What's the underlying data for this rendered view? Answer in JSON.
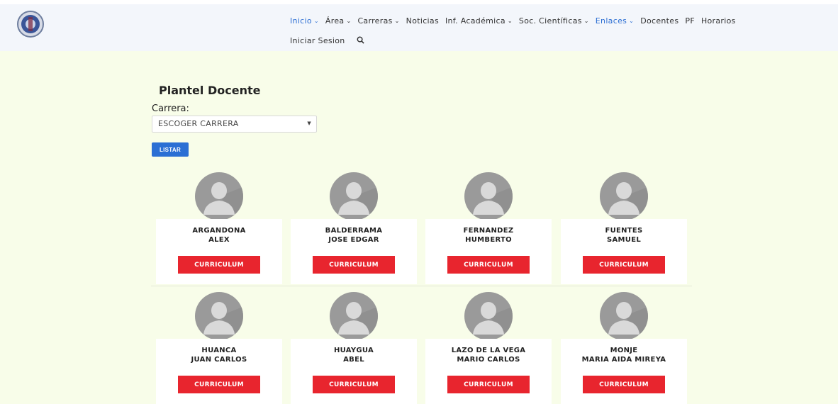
{
  "nav": {
    "row1": [
      {
        "label": "Inicio",
        "dropdown": true,
        "active": true
      },
      {
        "label": "Área",
        "dropdown": true,
        "active": false
      },
      {
        "label": "Carreras",
        "dropdown": true,
        "active": false
      },
      {
        "label": "Noticias",
        "dropdown": false,
        "active": false
      },
      {
        "label": "Inf. Académica",
        "dropdown": true,
        "active": false
      },
      {
        "label": "Soc. Científicas",
        "dropdown": true,
        "active": false
      },
      {
        "label": "Enlaces",
        "dropdown": true,
        "active": true
      },
      {
        "label": "Docentes",
        "dropdown": false,
        "active": false
      },
      {
        "label": "PF",
        "dropdown": false,
        "active": false
      },
      {
        "label": "Horarios",
        "dropdown": false,
        "active": false
      }
    ],
    "login": "Iniciar Sesion",
    "search_icon": "search-icon",
    "active_color": "#2d6fd3"
  },
  "page": {
    "title": "Plantel Docente",
    "carrera_label": "Carrera:",
    "select_value": "ESCOGER CARRERA",
    "listar_label": "LISTAR"
  },
  "docentes": [
    {
      "line1": "ARGANDONA",
      "line2": "ALEX",
      "button": "CURRICULUM"
    },
    {
      "line1": "BALDERRAMA",
      "line2": "JOSE EDGAR",
      "button": "CURRICULUM"
    },
    {
      "line1": "FERNANDEZ",
      "line2": "HUMBERTO",
      "button": "CURRICULUM"
    },
    {
      "line1": "FUENTES",
      "line2": "SAMUEL",
      "button": "CURRICULUM"
    },
    {
      "line1": "HUANCA",
      "line2": "JUAN CARLOS",
      "button": "CURRICULUM"
    },
    {
      "line1": "HUAYGUA",
      "line2": "ABEL",
      "button": "CURRICULUM"
    },
    {
      "line1": "LAZO DE LA VEGA",
      "line2": "MARIO CARLOS",
      "button": "CURRICULUM"
    },
    {
      "line1": "MONJE",
      "line2": "MARIA AIDA MIREYA",
      "button": "CURRICULUM"
    }
  ],
  "colors": {
    "page_bg": "#f8fde9",
    "navbar_bg": "#f3f6fb",
    "curriculum_button": "#e8252e",
    "listar_button": "#2b6fd4"
  }
}
